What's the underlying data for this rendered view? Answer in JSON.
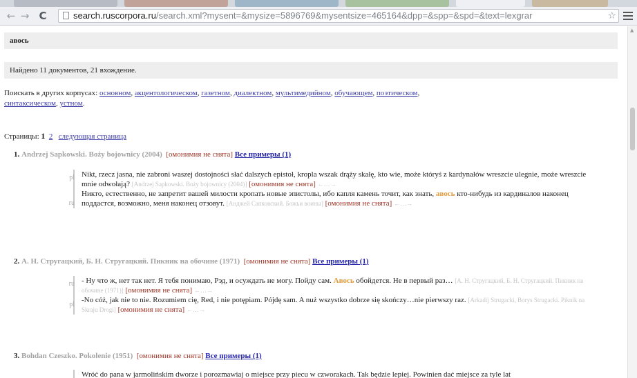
{
  "browser": {
    "url_host": "search.ruscorpora.ru",
    "url_path": "/search.xml?mysent=&mysize=5896769&mysentsize=465164&dpp=&spp=&spd=&text=lexgrar"
  },
  "query": "авось",
  "found": "Найдено 11 документов, 21 вхождение.",
  "other_corpora": {
    "label": "Поискать в других корпусах:",
    "links": [
      "основном",
      "акцентологическом",
      "газетном",
      "диалектном",
      "мультимедийном",
      "обучающем",
      "поэтическом",
      "синтаксическом",
      "устном"
    ]
  },
  "pagination": {
    "label": "Страницы:",
    "current": "1",
    "page2": "2",
    "next": "следующая страница"
  },
  "homonymy_label": "[омонимия не снята]",
  "all_examples_label": "Все примеры (1)",
  "nav_symbol": "←…→",
  "documents": [
    {
      "num": "1.",
      "title": "Andrzej Sapkowski. Boży bojownicy (2004)",
      "examples": [
        {
          "lang": "pl",
          "text": "Nikt, rzecz jasna, nie zabroni waszej dostojności słać dalszych epistoł, kropla wszak drąży skałę, kto wie, może któryś z kardynałów wreszcie ulegnie, może wreszcie mnie odwołają?",
          "source": "[Andrzej Sapkowski. Boży bojownicy (2004)]"
        },
        {
          "lang": "ru",
          "before": "Никто, естественно, не запретит вашей милости кропать новые эпистолы, ибо капля камень точит, как знать,",
          "highlight": "авось",
          "after": "кто-нибудь из кардиналов наконец поддастся, возможно, меня наконец отзовут.",
          "source": "[Анджей Сапковский. Божьи воины]"
        }
      ]
    },
    {
      "num": "2.",
      "title": "А. Н. Стругацкий, Б. Н. Стругацкий. Пикник на обочине (1971)",
      "examples": [
        {
          "lang": "ru",
          "before": "- Ну что ж, нет так нет. Я тебя понимаю, Рэд, и осуждать не могу. Пойду сам.",
          "highlight": "Авось",
          "after": "обойдется. Не в первый раз…",
          "source": "[А. Н. Стругацкий, Б. Н. Стругацкий. Пикник на обочине (1971)]"
        },
        {
          "lang": "pl",
          "text": "-No cóż, jak nie to nie. Rozumiem cię, Red, i nie potępiam. Pójdę sam. A nuż wszystko dobrze się skończy…nie pierwszy raz.",
          "source": "[Arkadij Strugacki, Borys Strugacki. Piknik na Skraju Drogi]"
        }
      ]
    },
    {
      "num": "3.",
      "title": "Bohdan Czeszko. Pokolenie (1951)",
      "examples": [
        {
          "text": "Wróć do pana w jarmolińskim dworze i porozmawiaj o miejsce przy piecu w czworakach. Tak będzie lepiej. Powinien dać miejsce za tyle lat"
        }
      ]
    }
  ]
}
